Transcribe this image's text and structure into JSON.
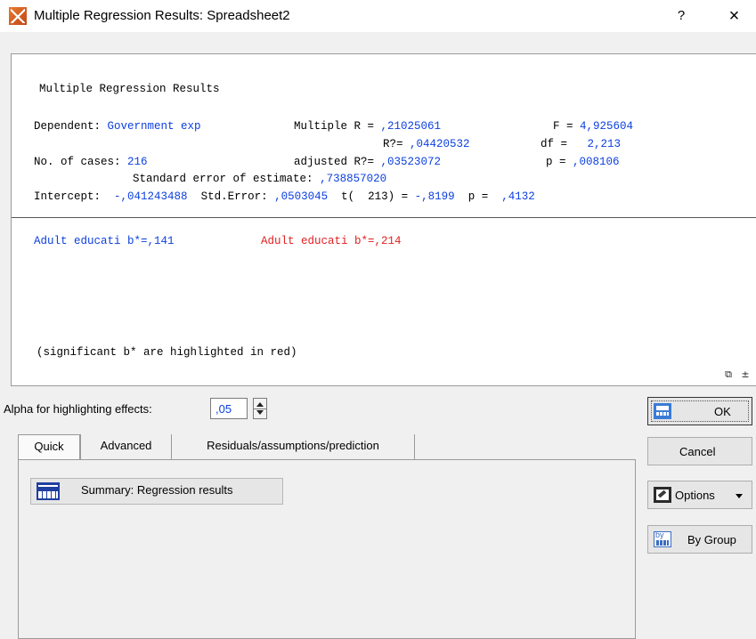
{
  "window": {
    "title": "Multiple Regression Results: Spreadsheet2",
    "help_label": "?",
    "close_label": "×"
  },
  "results": {
    "heading": "Multiple Regression Results",
    "dependent_label": "Dependent:",
    "dependent_value": "Government exp",
    "multiple_r_label": "Multiple R =",
    "multiple_r_value": ",21025061",
    "f_label": "F =",
    "f_value": "4,925604",
    "r2_label": "R?=",
    "r2_value": ",04420532",
    "df_label": "df =",
    "df_value": "2,213",
    "cases_label": "No. of cases:",
    "cases_value": "216",
    "adj_r2_label": "adjusted R?=",
    "adj_r2_value": ",03523072",
    "p_label": "p =",
    "p_value": ",008106",
    "std_err_est_label": "Standard error of estimate:",
    "std_err_est_value": ",738857020",
    "intercept_label": "Intercept:",
    "intercept_value": "-,041243488",
    "std_error_label": "Std.Error:",
    "std_error_value": ",0503045",
    "t_label": "t(  213) =",
    "t_value": "-,8199",
    "p2_label": "p =",
    "p2_value": ",4132",
    "beta_1": "Adult educati b*=,141",
    "beta_2": "Adult educati b*=,214",
    "note": "(significant b* are highlighted in red)"
  },
  "alpha": {
    "label": "Alpha for highlighting effects:",
    "value": ",05"
  },
  "tabs": [
    {
      "label": "Quick"
    },
    {
      "label": "Advanced"
    },
    {
      "label": "Residuals/assumptions/prediction"
    }
  ],
  "quick": {
    "summary_label": "Summary:  Regression results"
  },
  "buttons": {
    "ok": "OK",
    "cancel": "Cancel",
    "options": "Options",
    "by_group": "By Group"
  },
  "colors": {
    "blue_values": "#0b3fe0",
    "red_highlight": "#e21f1f"
  }
}
